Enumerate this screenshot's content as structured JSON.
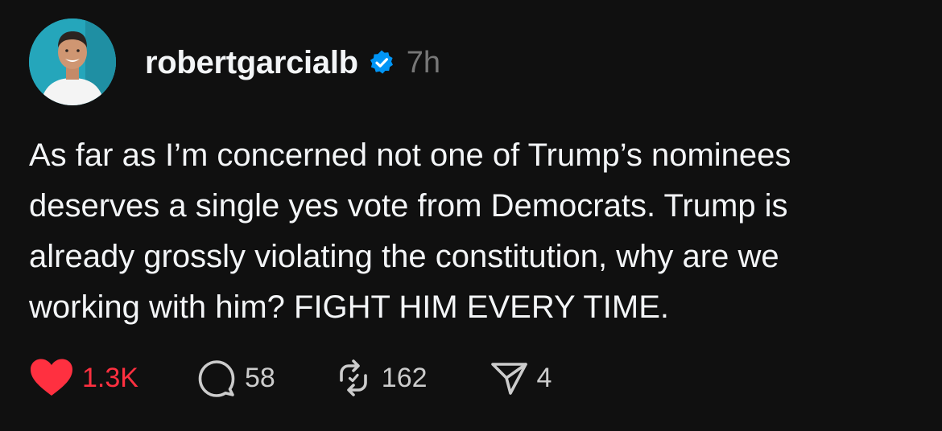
{
  "post": {
    "author": {
      "username": "robertgarcialb",
      "verified": true,
      "avatar_icon": "profile-photo"
    },
    "timestamp": "7h",
    "text_lines": [
      "As far as I’m concerned not one of Trump’s nominees",
      "deserves a single yes vote from Democrats. Trump is",
      "already grossly violating the constitution, why are we",
      "working with him? FIGHT HIM EVERY TIME."
    ],
    "actions": {
      "like": {
        "icon": "heart-icon",
        "count": "1.3K",
        "liked": true,
        "color": "#ff3040"
      },
      "reply": {
        "icon": "comment-icon",
        "count": "58"
      },
      "repost": {
        "icon": "repost-icon",
        "count": "162"
      },
      "share": {
        "icon": "send-icon",
        "count": "4"
      }
    },
    "colors": {
      "background": "#101010",
      "text": "#f3f5f7",
      "muted": "#777777",
      "verified": "#0095f6",
      "like": "#ff3040"
    }
  }
}
